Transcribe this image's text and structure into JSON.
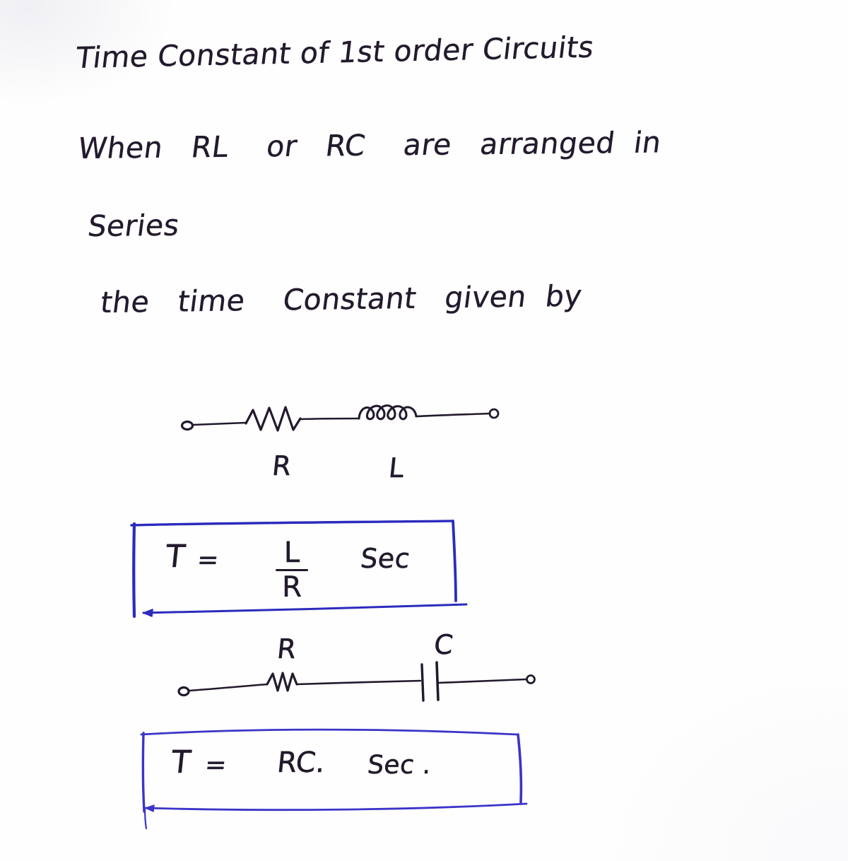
{
  "document": {
    "kind": "handwritten-notes",
    "background_color": "#fefefe",
    "ink_color": "#231a2d",
    "box_ink_color": "#2b2bbd"
  },
  "title": "Time Constant of 1st order Circuits",
  "body_lines": [
    "When   RL    or   RC    are   arranged  in",
    "Series",
    "the   time    Constant   given  by"
  ],
  "circuits": [
    {
      "id": "rl-series-circuit",
      "name": "RL series circuit",
      "components": [
        {
          "type": "terminal",
          "label": ""
        },
        {
          "type": "resistor",
          "label": "R"
        },
        {
          "type": "inductor",
          "label": "L"
        },
        {
          "type": "terminal",
          "label": ""
        }
      ]
    },
    {
      "id": "rc-series-circuit",
      "name": "RC series circuit",
      "components": [
        {
          "type": "terminal",
          "label": ""
        },
        {
          "type": "resistor",
          "label": "R"
        },
        {
          "type": "capacitor",
          "label": "C"
        },
        {
          "type": "terminal",
          "label": ""
        }
      ]
    }
  ],
  "formulas": [
    {
      "id": "rl-time-constant",
      "symbol": "T",
      "equals": "=",
      "numerator": "L",
      "denominator": "R",
      "unit": "Sec",
      "plain": "T = L/R  Sec"
    },
    {
      "id": "rc-time-constant",
      "symbol": "T",
      "equals": "=",
      "expression": "RC.",
      "unit": "Sec .",
      "plain": "T = RC.  Sec ."
    }
  ],
  "labels": {
    "rl_resistor": "R",
    "rl_inductor": "L",
    "rc_resistor": "R",
    "rc_capacitor": "C"
  }
}
